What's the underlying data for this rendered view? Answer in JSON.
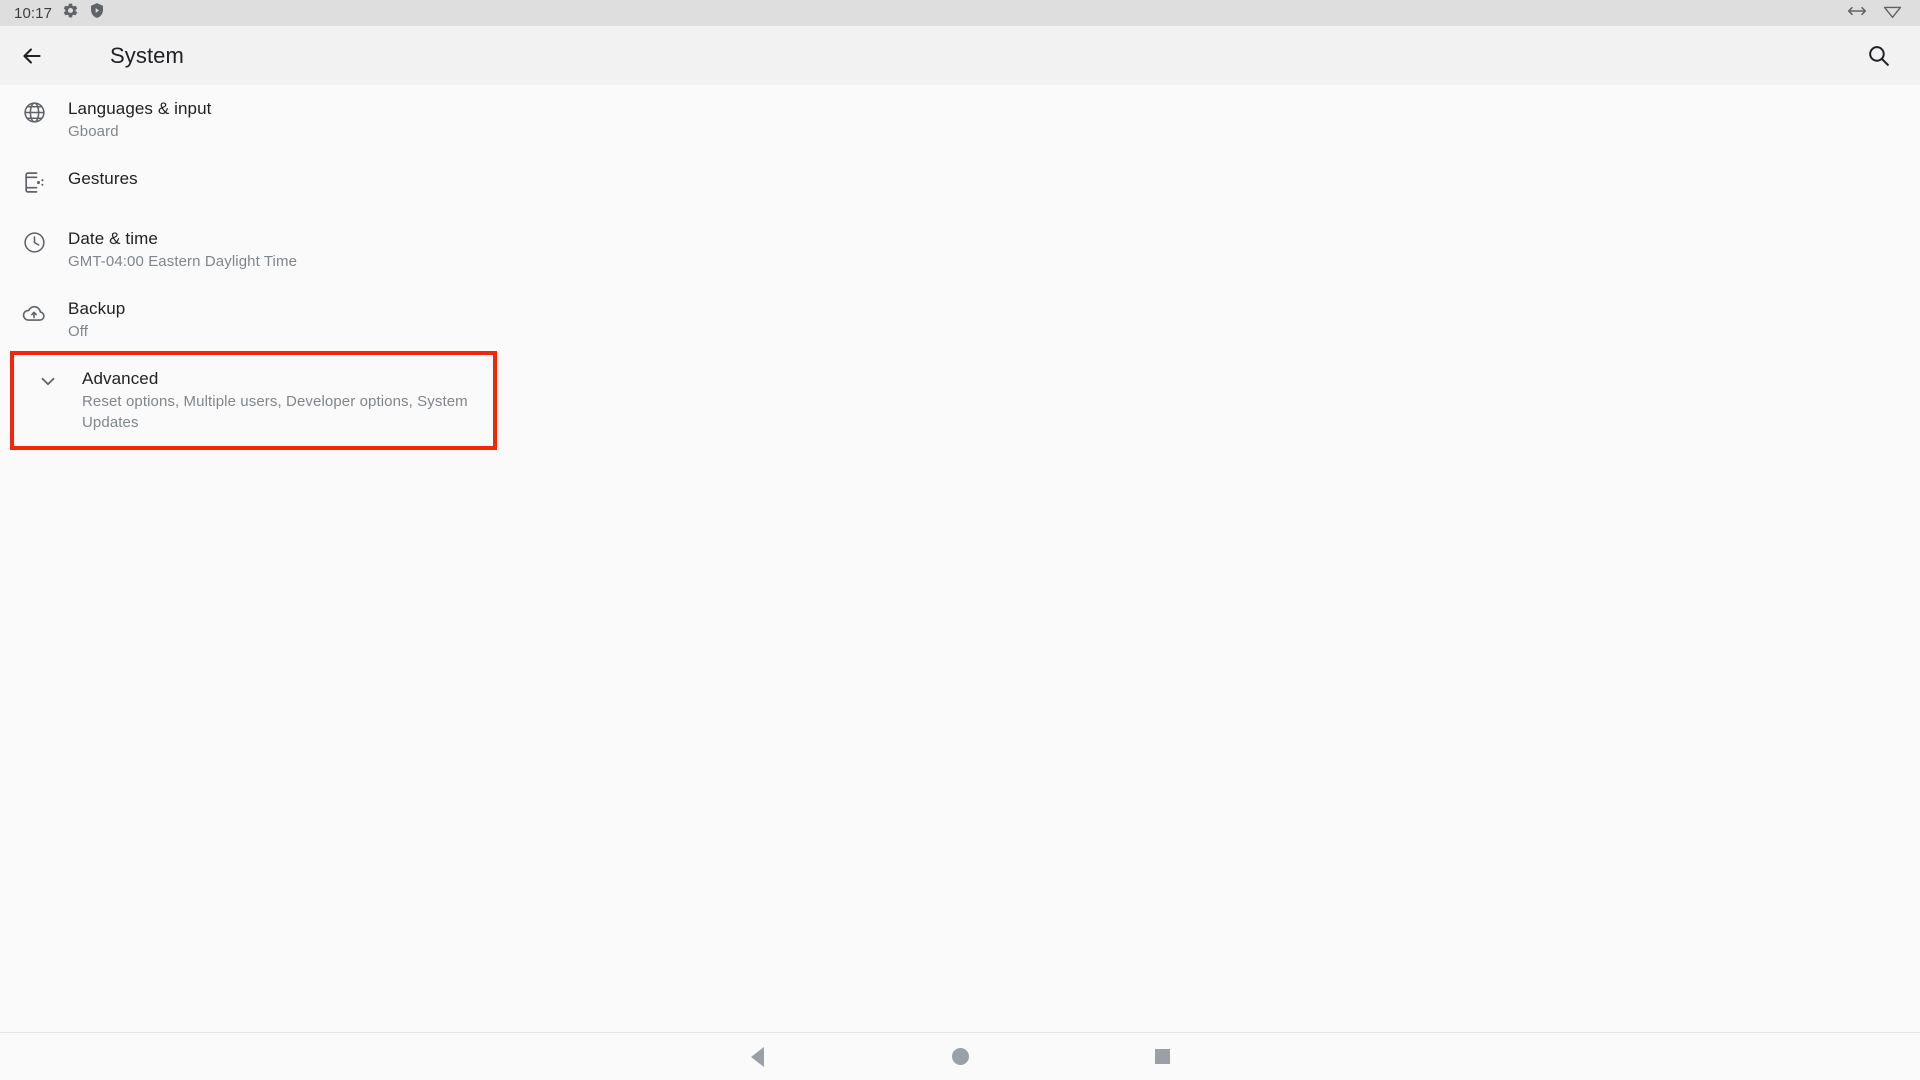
{
  "status_bar": {
    "clock": "10:17",
    "left_icons": [
      "gear-icon",
      "shield-vpn-icon"
    ],
    "right_icons": [
      "horizontal-resize-icon",
      "wifi-icon"
    ],
    "background_color": "#dedede"
  },
  "app_bar": {
    "back_icon": "arrow-left-icon",
    "title": "System",
    "search_icon": "search-icon",
    "background_color": "#f2f2f2"
  },
  "settings": {
    "items": [
      {
        "icon": "globe-icon",
        "title": "Languages & input",
        "subtitle": "Gboard",
        "highlighted": false
      },
      {
        "icon": "gestures-phone-icon",
        "title": "Gestures",
        "subtitle": "",
        "highlighted": false
      },
      {
        "icon": "clock-icon",
        "title": "Date & time",
        "subtitle": "GMT-04:00 Eastern Daylight Time",
        "highlighted": false
      },
      {
        "icon": "cloud-upload-icon",
        "title": "Backup",
        "subtitle": "Off",
        "highlighted": false
      },
      {
        "icon": "chevron-down-icon",
        "title": "Advanced",
        "subtitle": "Reset options, Multiple users, Developer options, System Updates",
        "highlighted": true
      }
    ],
    "highlight_color": "#f4260a"
  },
  "nav_bar": {
    "back_label": "Back",
    "home_label": "Home",
    "recents_label": "Recents",
    "icon_color": "#9aa0a6"
  }
}
